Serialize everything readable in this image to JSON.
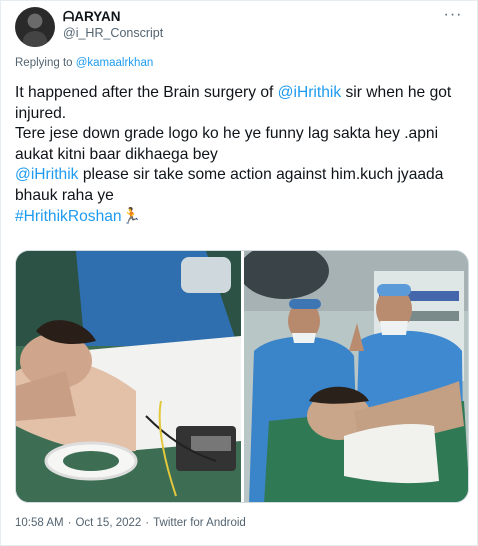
{
  "user": {
    "display_name": "ᗩARYAN",
    "handle": "@i_HR_Conscript"
  },
  "reply": {
    "prefix": "Replying to ",
    "mention": "@kamaalrkhan"
  },
  "tweet": {
    "line1_a": "It happened after the Brain surgery of ",
    "line1_mention": "@iHrithik",
    "line1_b": " sir when he got injured.",
    "line2": "Tere jese down grade logo ko he ye funny lag sakta hey .apni aukat kitni baar dikhaega bey",
    "line3_mention": "@iHrithik",
    "line3_b": " please sir take some action against him.kuch jyaada bhauk raha ye",
    "hashtag": "#HrithikRoshan",
    "hashtag_emoji": "🏃"
  },
  "footer": {
    "time": "10:58 AM",
    "sep1": "·",
    "date": "Oct 15, 2022",
    "sep2": "·",
    "source": "Twitter for Android"
  },
  "icons": {
    "more": "more-icon"
  }
}
